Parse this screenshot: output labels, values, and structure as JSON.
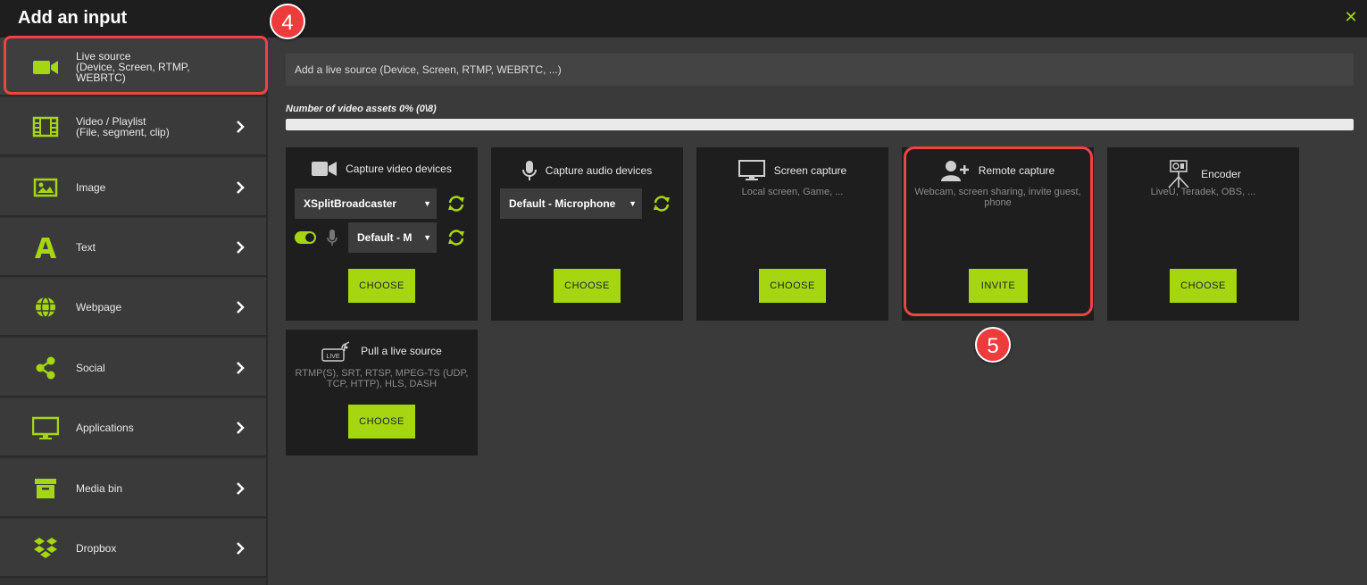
{
  "header": {
    "title": "Add an input"
  },
  "callouts": {
    "four": "4",
    "five": "5"
  },
  "sidebar": {
    "items": [
      {
        "label": "Live source\n(Device, Screen, RTMP,\nWEBRTC)",
        "icon": "video-camera-icon"
      },
      {
        "label": "Video / Playlist\n(File, segment, clip)",
        "icon": "film-icon"
      },
      {
        "label": "Image",
        "icon": "image-icon"
      },
      {
        "label": "Text",
        "icon": "text-a-icon"
      },
      {
        "label": "Webpage",
        "icon": "globe-icon"
      },
      {
        "label": "Social",
        "icon": "share-icon"
      },
      {
        "label": "Applications",
        "icon": "monitor-icon"
      },
      {
        "label": "Media bin",
        "icon": "archive-box-icon"
      },
      {
        "label": "Dropbox",
        "icon": "dropbox-icon"
      }
    ]
  },
  "search": {
    "placeholder": "Add a live source (Device, Screen, RTMP, WEBRTC, ...)"
  },
  "progress": {
    "label": "Number of video assets 0% (0\\8)",
    "percent": 0
  },
  "cards": {
    "video": {
      "title": "Capture video devices",
      "device": "XSplitBroadcaster",
      "audio": "Default - M",
      "button": "CHOOSE"
    },
    "audio": {
      "title": "Capture audio devices",
      "device": "Default - Microphone",
      "button": "CHOOSE"
    },
    "screen": {
      "title": "Screen capture",
      "desc": "Local screen, Game, ...",
      "button": "CHOOSE"
    },
    "remote": {
      "title": "Remote capture",
      "desc": "Webcam, screen sharing, invite guest, phone",
      "button": "INVITE"
    },
    "encoder": {
      "title": "Encoder",
      "desc": "LiveU, Teradek, OBS, ...",
      "button": "CHOOSE"
    },
    "pull": {
      "title": "Pull a live source",
      "desc": "RTMP(S), SRT, RTSP, MPEG-TS (UDP, TCP, HTTP), HLS, DASH",
      "button": "CHOOSE",
      "icon_text": "LIVE"
    }
  },
  "colors": {
    "accent": "#a5d610",
    "callout": "#ee3b3b",
    "card_bg": "#1e1e1e",
    "background": "#3a3a3a"
  }
}
